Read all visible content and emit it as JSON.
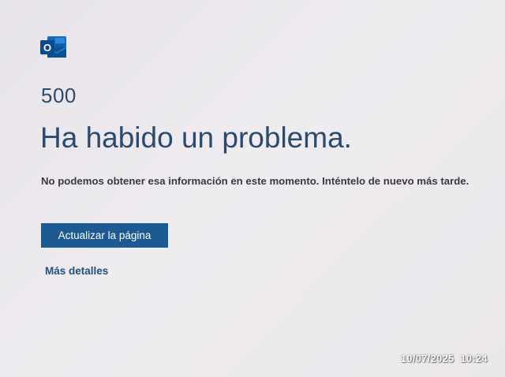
{
  "app": {
    "logo_icon": "outlook-logo-icon",
    "logo_letter": "O",
    "brand_color": "#0f6cbd"
  },
  "error": {
    "code": "500",
    "title": "Ha habido un problema.",
    "message": "No podemos obtener esa información en este momento. Inténtelo de nuevo más tarde."
  },
  "actions": {
    "refresh_label": "Actualizar la página",
    "details_label": "Más detalles",
    "button_color": "#1d5a93",
    "link_color": "#1d4f82"
  },
  "overlay": {
    "timestamp": "10/07/2025  10:24"
  }
}
